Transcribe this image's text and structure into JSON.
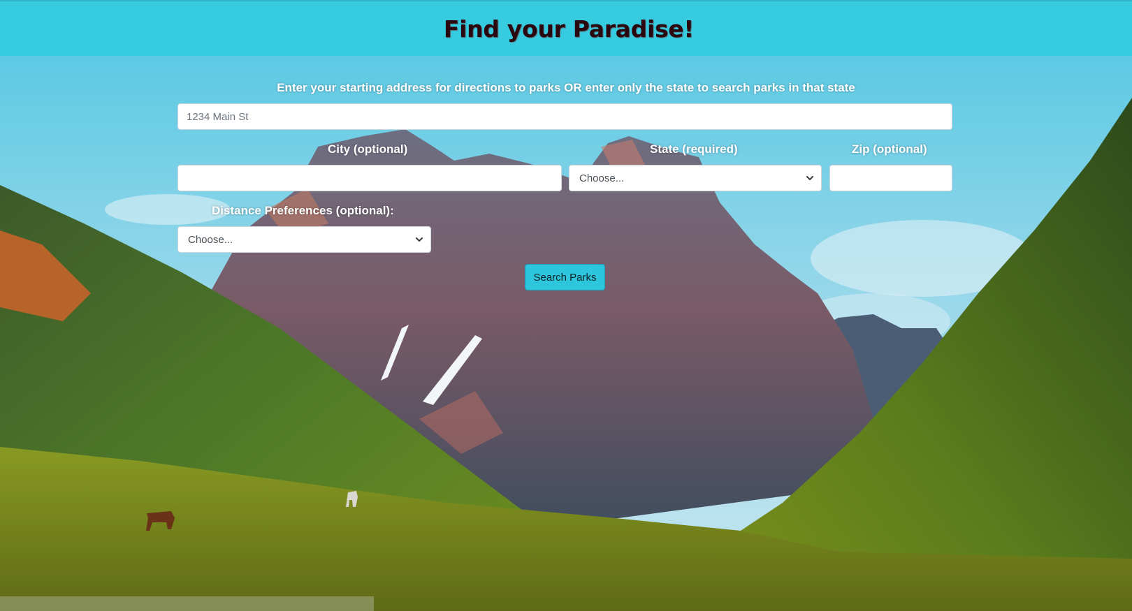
{
  "header": {
    "title": "Find your Paradise!"
  },
  "form": {
    "address_label": "Enter your starting address for directions to parks OR enter only the state to search parks in that state",
    "address_placeholder": "1234 Main St",
    "city_label": "City (optional)",
    "state_label": "State (required)",
    "state_selected": "Choose...",
    "zip_label": "Zip (optional)",
    "distance_label": "Distance Preferences (optional):",
    "distance_selected": "Choose...",
    "submit_label": "Search Parks"
  },
  "icons": {
    "state_select_arrow": "chevron-down-icon",
    "distance_select_arrow": "chevron-down-icon"
  },
  "colors": {
    "header_bg": "#37cbe0",
    "title_text": "#2a0810",
    "button_bg": "#2ec6dd"
  }
}
